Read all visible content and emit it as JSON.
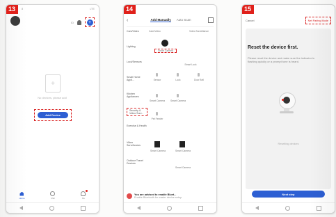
{
  "steps": [
    "13",
    "14",
    "15"
  ],
  "phone13": {
    "status": {
      "time": "8",
      "signal": "LTE"
    },
    "top_text": "ID",
    "empty_text": "No devices, please add",
    "add_device": "Add Device",
    "tabs": [
      "Home",
      "Mall",
      "Me"
    ]
  },
  "phone14": {
    "tab_add_manually": "Add Manually",
    "tab_auto_scan": "Auto Scan",
    "sidebar": [
      "Cam/Video",
      "Lighting",
      "Lock/Sensors",
      "Small Home Appli...",
      "Kitchen Appliances",
      "Security & Video Surv...",
      "Exercise & Health",
      "Video Surv/Access",
      "Outdoor Travel Devices"
    ],
    "top_label_left": "Cam/Video",
    "top_label_right": "Video Surveillance",
    "cells": [
      "Smart Camera",
      "Smart Lock",
      "Sensor",
      "Lock",
      "Door Bell",
      "Smart Camera",
      "Smart Camera",
      "Pet Feeder",
      "Smart Camera",
      "Smart Camera",
      "Smart Camera"
    ],
    "banner_title": "You are advised to enable Bluet...",
    "banner_sub": "Enable Bluetooth for easier device setup"
  },
  "phone15": {
    "cancel": "Cancel",
    "mode": "Net Pairing Mode",
    "title": "Reset the device first.",
    "desc": "Please reset the device and make sure the indicator is flashing quickly or a prompt tone is heard.",
    "reset_link": "Resetting devices",
    "next": "Next step"
  },
  "colors": {
    "accent": "#2d5fd3",
    "step_badge": "#e0211b",
    "highlight": "#d92020"
  }
}
